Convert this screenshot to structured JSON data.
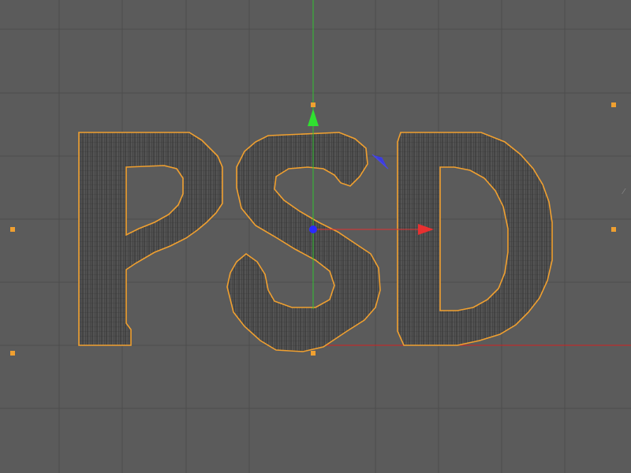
{
  "viewport": {
    "background": "#5b5b5b",
    "grid_color": "#4f4f4f",
    "object_text": "PSD",
    "selection_color": "#f0a030",
    "mesh_fill": "#505050",
    "mesh_line": "#2a2a2a"
  },
  "gizmo": {
    "x_axis_color": "#e03030",
    "y_axis_color": "#30d030",
    "z_axis_color": "#4040e0",
    "center_color": "#3030ff",
    "icons": [
      "move-x-arrow-icon",
      "move-y-arrow-icon",
      "move-z-plane-icon",
      "pivot-center-icon"
    ]
  }
}
